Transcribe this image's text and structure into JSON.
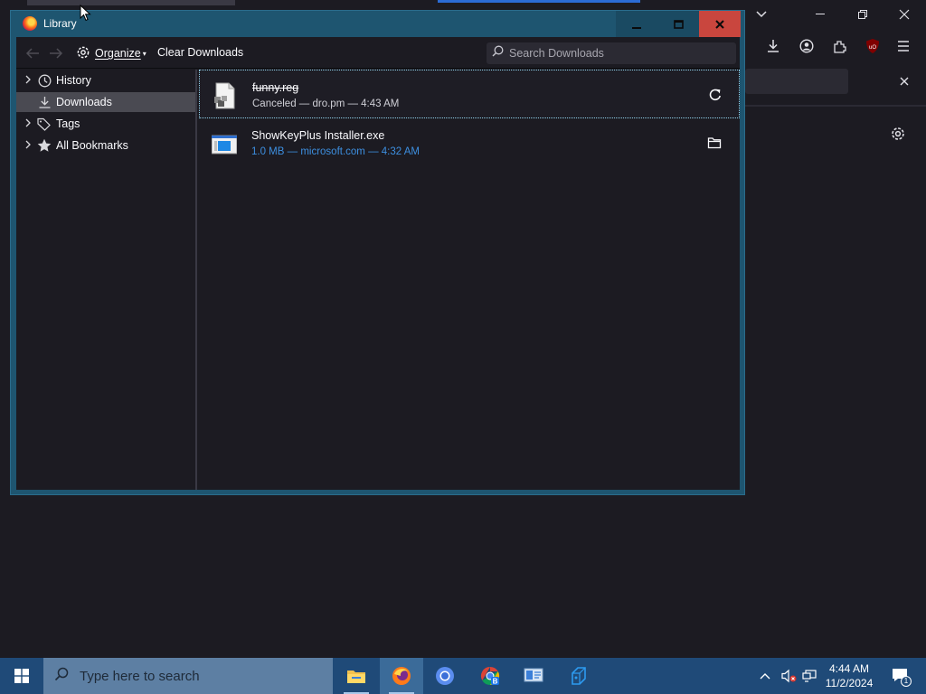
{
  "library": {
    "title": "Library",
    "toolbar": {
      "back_icon": "arrow-left-icon",
      "forward_icon": "arrow-right-icon",
      "organize_label": "Organize",
      "clear_label": "Clear Downloads",
      "search_placeholder": "Search Downloads"
    },
    "sidebar": {
      "items": [
        {
          "label": "History",
          "icon": "clock-icon",
          "expandable": true,
          "selected": false
        },
        {
          "label": "Downloads",
          "icon": "download-icon",
          "expandable": false,
          "selected": true
        },
        {
          "label": "Tags",
          "icon": "tag-icon",
          "expandable": true,
          "selected": false
        },
        {
          "label": "All Bookmarks",
          "icon": "star-icon",
          "expandable": true,
          "selected": false
        }
      ]
    },
    "downloads": [
      {
        "name": "funny.reg",
        "status": "Canceled — dro.pm — 4:43 AM",
        "state": "canceled",
        "action_icon": "retry-icon",
        "selected": true
      },
      {
        "name": "ShowKeyPlus Installer.exe",
        "status": "1.0 MB — microsoft.com — 4:32 AM",
        "state": "finished",
        "action_icon": "folder-icon",
        "selected": false
      }
    ]
  },
  "taskbar": {
    "search_placeholder": "Type here to search",
    "apps": [
      "file-explorer-icon",
      "firefox-icon",
      "chromium-icon",
      "chrome-beta-icon",
      "system-info-icon",
      "mspaint-icon"
    ],
    "clock": {
      "time": "4:44 AM",
      "date": "11/2/2024"
    },
    "notification_count": "1"
  },
  "colors": {
    "library_frame": "#1e5570",
    "close_button": "#c9463e",
    "panel_bg": "#1c1b22",
    "link_blue": "#3d8fe0",
    "taskbar": "#1f4a78"
  }
}
